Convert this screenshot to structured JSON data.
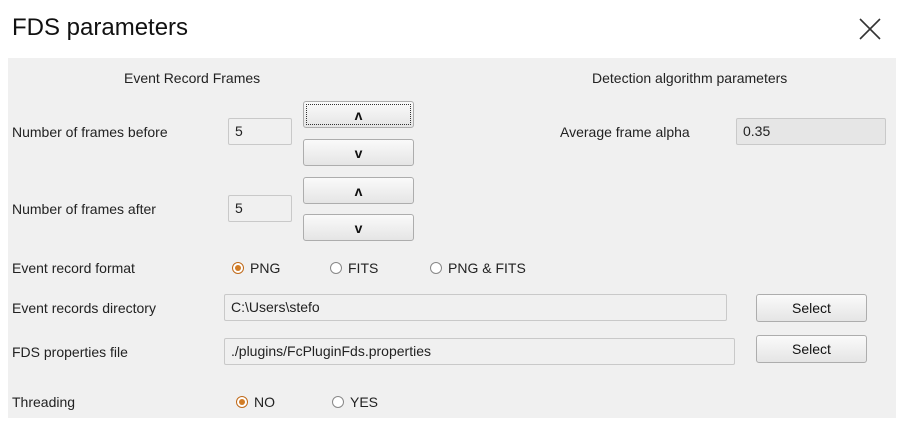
{
  "window": {
    "title": "FDS parameters"
  },
  "event_record_frames": {
    "heading": "Event Record Frames",
    "before_label": "Number of frames before",
    "before_value": "5",
    "after_label": "Number of frames after",
    "after_value": "5",
    "up_glyph": "ʌ",
    "down_glyph": "v"
  },
  "detection": {
    "heading": "Detection algorithm parameters",
    "alpha_label": "Average frame alpha",
    "alpha_value": "0.35"
  },
  "format": {
    "label": "Event record format",
    "options": [
      "PNG",
      "FITS",
      "PNG & FITS"
    ],
    "selected": "PNG"
  },
  "directory": {
    "label": "Event records directory",
    "value": "C:\\Users\\stefo",
    "button": "Select"
  },
  "properties": {
    "label": "FDS properties file",
    "value": "./plugins/FcPluginFds.properties",
    "button": "Select"
  },
  "threading": {
    "label": "Threading",
    "options": [
      "NO",
      "YES"
    ],
    "selected": "NO"
  }
}
